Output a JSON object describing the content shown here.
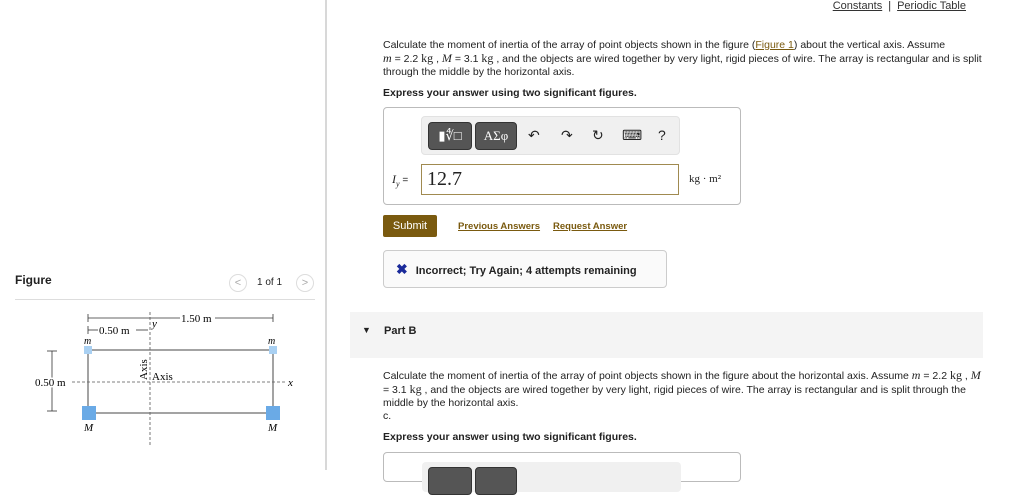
{
  "top_links": {
    "constants": "Constants",
    "separator": "|",
    "periodic_table": "Periodic Table"
  },
  "part_a": {
    "q_pre": "Calculate the moment of inertia of the array of point objects shown in the figure (",
    "figure_link": "Figure 1",
    "q_mid": ") about the vertical axis. Assume",
    "m_sym": "m",
    "m_val": " = 2.2 ",
    "kg": "kg",
    "M_sym": "M",
    "M_val": " = 3.1 ",
    "q_post": ", and the objects are wired together by very light, rigid pieces of wire. The array is rectangular and is split through the middle by the horizontal axis.",
    "instruction": "Express your answer using two significant figures.",
    "toolbar": {
      "templates": "▮∜□",
      "greek": "ΑΣφ",
      "undo": "↶",
      "redo": "↷",
      "reset": "↻",
      "keyboard": "⌨",
      "help": "?"
    },
    "var_label": "I",
    "var_sub": "y",
    "equals": " =",
    "answer_value": "12.7",
    "units": "kg · m²",
    "submit": "Submit",
    "previous_answers": "Previous Answers",
    "request_answer": "Request Answer",
    "feedback": "Incorrect; Try Again; 4 attempts remaining"
  },
  "figure": {
    "title": "Figure",
    "pager": "1 of 1",
    "prev": "<",
    "next": ">",
    "dim_width": "1.50 m",
    "dim_offset": "0.50 m",
    "dim_height": "0.50 m",
    "y_label": "y",
    "x_label": "x",
    "axis_label": "Axis",
    "axis_label_rotated": "Axis",
    "mass_small": "m",
    "mass_large": "M"
  },
  "part_b": {
    "title": "Part B",
    "q_pre": "Calculate the moment of inertia of the array of point objects shown in the figure about the horizontal axis. Assume ",
    "m_sym": "m",
    "m_val": " = 2.2 ",
    "kg": "kg",
    "M_sym": "M",
    "M_val": " = 3.1 ",
    "q_post": ", and the objects are wired together by very light, rigid pieces of wire. The array is rectangular and is split through the middle by the horizontal axis.",
    "extra": "c.",
    "instruction": "Express your answer using two significant figures."
  },
  "colors": {
    "accent": "#7a5a0f",
    "mass": "#7ab4e8"
  }
}
